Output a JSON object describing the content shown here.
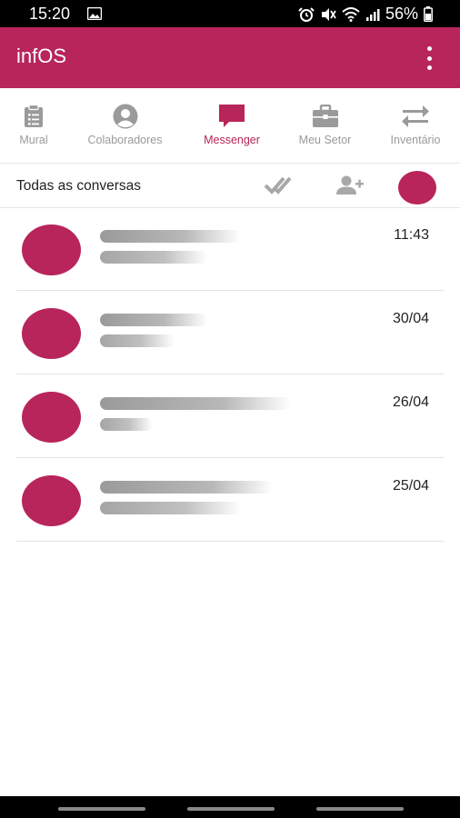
{
  "status_bar": {
    "time": "15:20",
    "battery": "56%",
    "icons": [
      "image-icon",
      "alarm-icon",
      "mute-icon",
      "wifi-icon",
      "signal-icon",
      "battery-icon"
    ]
  },
  "app_bar": {
    "title": "infOS",
    "menu_icon": "more-vertical-icon"
  },
  "tabs": [
    {
      "label": "Mural",
      "icon": "clipboard-icon",
      "active": false
    },
    {
      "label": "Colaboradores",
      "icon": "user-circle-icon",
      "active": false
    },
    {
      "label": "Messenger",
      "icon": "chat-icon",
      "active": true
    },
    {
      "label": "Meu Setor",
      "icon": "briefcase-icon",
      "active": false
    },
    {
      "label": "Inventário",
      "icon": "swap-icon",
      "active": false
    }
  ],
  "filter": {
    "title": "Todas as conversas",
    "icons": [
      "double-check-icon",
      "add-user-icon",
      "avatar-icon"
    ]
  },
  "conversations": [
    {
      "date": "11:43"
    },
    {
      "date": "30/04"
    },
    {
      "date": "26/04"
    },
    {
      "date": "25/04"
    }
  ],
  "colors": {
    "accent": "#B8255A",
    "inactive": "#9a9a9a"
  }
}
